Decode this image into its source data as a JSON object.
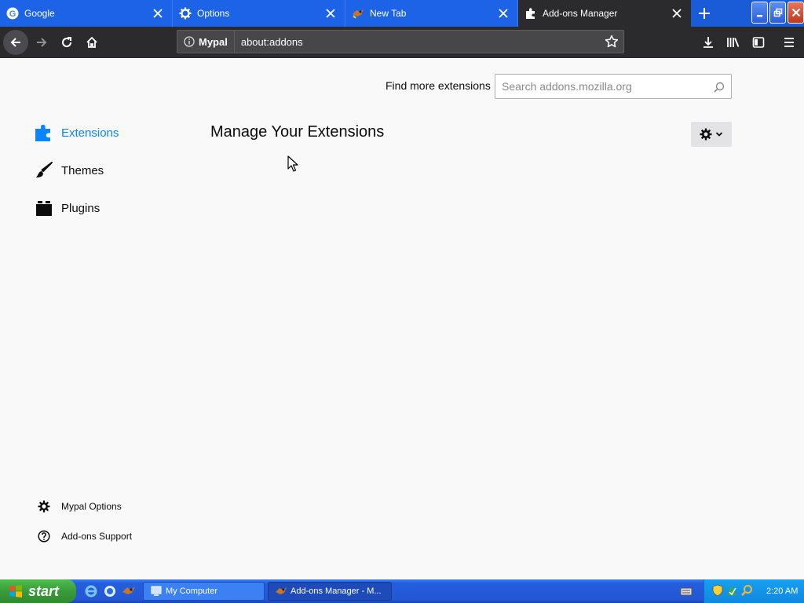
{
  "tabs": [
    {
      "label": "Google",
      "icon": "google-icon",
      "active": false
    },
    {
      "label": "Options",
      "icon": "gear-icon",
      "active": false
    },
    {
      "label": "New Tab",
      "icon": "mypal-logo-icon",
      "active": false
    },
    {
      "label": "Add-ons Manager",
      "icon": "puzzle-icon",
      "active": true
    }
  ],
  "navbar": {
    "identity_label": "Mypal",
    "url": "about:addons"
  },
  "search": {
    "label": "Find more extensions",
    "placeholder": "Search addons.mozilla.org"
  },
  "categories": [
    {
      "label": "Extensions",
      "icon": "puzzle-icon",
      "selected": true
    },
    {
      "label": "Themes",
      "icon": "brush-icon",
      "selected": false
    },
    {
      "label": "Plugins",
      "icon": "plugin-icon",
      "selected": false
    }
  ],
  "main": {
    "title": "Manage Your Extensions"
  },
  "footer_links": [
    {
      "label": "Mypal Options",
      "icon": "gear-icon"
    },
    {
      "label": "Add-ons Support",
      "icon": "help-icon"
    }
  ],
  "taskbar": {
    "start_label": "start",
    "items": [
      {
        "label": "My Computer",
        "icon": "computer-icon",
        "active": false
      },
      {
        "label": "Add-ons Manager - M...",
        "icon": "mypal-logo-icon",
        "active": true
      }
    ],
    "clock": "2:20 AM"
  },
  "colors": {
    "accent": "#0a84ff",
    "tabstrip": "#1c63e8",
    "toolbar": "#2b2b2e",
    "taskbar": "#245edc",
    "start": "#3a9b3a"
  }
}
